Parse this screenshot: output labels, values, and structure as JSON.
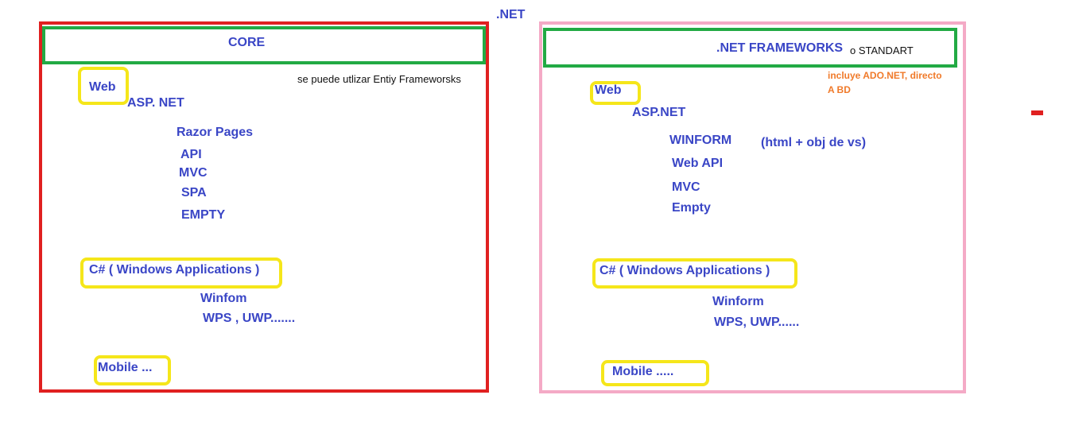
{
  "title": ".NET",
  "colors": {
    "core_border": "#e02020",
    "frameworks_border": "#f4aac6",
    "header_border": "#22aa44",
    "highlight": "#f5e61a",
    "text_blue": "#3a46c6",
    "note_orange": "#f07a2a"
  },
  "left": {
    "header": "CORE",
    "note": "se puede utlizar Entiy Frameworsks",
    "web": "Web",
    "asp": "ASP. NET",
    "items": [
      "Razor Pages",
      "API",
      "MVC",
      "SPA",
      "EMPTY"
    ],
    "csharp": "C#   ( Windows Applications )",
    "win_items": [
      "Winfom",
      "WPS , UWP......."
    ],
    "mobile": "Mobile ..."
  },
  "right": {
    "header": ".NET FRAMEWORKS",
    "header_suffix": "o STANDART",
    "note": [
      "incluye ADO.NET, directo",
      "A BD"
    ],
    "web": "Web",
    "asp": "ASP.NET",
    "items": [
      "WINFORM",
      "Web API",
      "MVC",
      "Empty"
    ],
    "winform_note": "(html + obj de vs)",
    "csharp": "C#  ( Windows Applications )",
    "win_items": [
      "Winform",
      "WPS, UWP......"
    ],
    "mobile": "Mobile ....."
  }
}
